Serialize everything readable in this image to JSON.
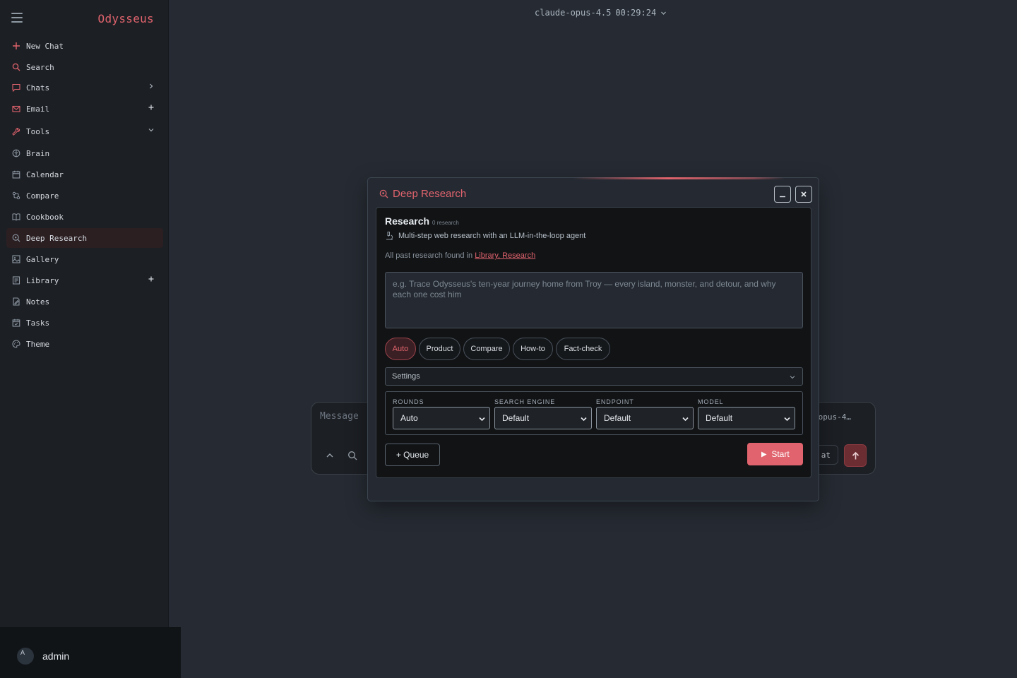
{
  "app": {
    "brand": "Odysseus"
  },
  "sidebar": {
    "items": [
      {
        "label": "New Chat",
        "icon": "plus-icon"
      },
      {
        "label": "Search",
        "icon": "search-icon"
      },
      {
        "label": "Chats",
        "icon": "chat-icon"
      },
      {
        "label": "Email",
        "icon": "mail-icon"
      },
      {
        "label": "Tools",
        "icon": "wrench-icon"
      },
      {
        "label": "Brain",
        "icon": "brain-icon"
      },
      {
        "label": "Calendar",
        "icon": "calendar-icon"
      },
      {
        "label": "Compare",
        "icon": "compare-icon"
      },
      {
        "label": "Cookbook",
        "icon": "book-icon"
      },
      {
        "label": "Deep Research",
        "icon": "research-icon"
      },
      {
        "label": "Gallery",
        "icon": "image-icon"
      },
      {
        "label": "Library",
        "icon": "library-icon"
      },
      {
        "label": "Notes",
        "icon": "notes-icon"
      },
      {
        "label": "Tasks",
        "icon": "tasks-icon"
      },
      {
        "label": "Theme",
        "icon": "palette-icon"
      }
    ],
    "active": "Deep Research"
  },
  "user": {
    "avatar_initial": "A",
    "name": "admin"
  },
  "header": {
    "model": "claude-opus-4.5",
    "time": "00:29:24"
  },
  "composer": {
    "placeholder": "Message",
    "model_short": "opus-4…",
    "chat_button": "at"
  },
  "modal": {
    "title": "Deep Research",
    "panel_title": "Research",
    "panel_subtitle": "0 research",
    "description": "Multi-step web research with an LLM-in-the-loop agent",
    "past_prefix": "All past research found in",
    "past_link": "Library, Research",
    "query_placeholder": "e.g. Trace Odysseus's ten-year journey home from Troy — every island, monster, and detour, and why each one cost him",
    "modes": [
      "Auto",
      "Product",
      "Compare",
      "How-to",
      "Fact-check"
    ],
    "active_mode": "Auto",
    "settings_label": "Settings",
    "fields": [
      {
        "label": "ROUNDS",
        "value": "Auto"
      },
      {
        "label": "SEARCH ENGINE",
        "value": "Default"
      },
      {
        "label": "ENDPOINT",
        "value": "Default"
      },
      {
        "label": "MODEL",
        "value": "Default"
      }
    ],
    "queue_label": "+ Queue",
    "start_label": "Start"
  },
  "colors": {
    "accent": "#e0636d",
    "background": "#262b33",
    "sidebar": "#1c1f24",
    "panel": "#111315"
  }
}
